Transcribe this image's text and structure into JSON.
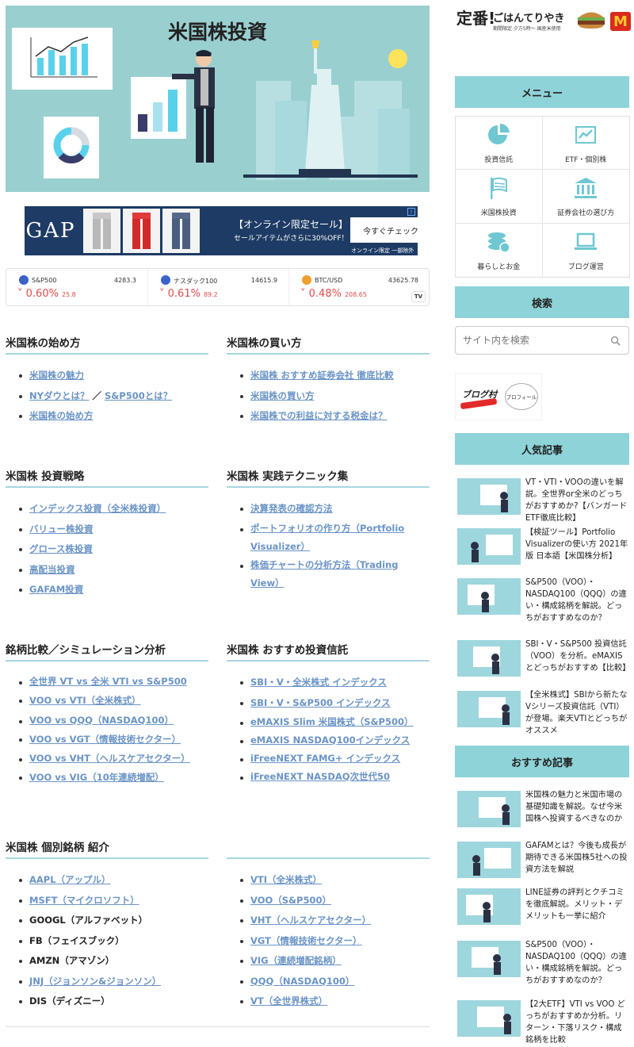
{
  "hero": {
    "title": "米国株投資"
  },
  "ad": {
    "logo": "GAP",
    "headline": "【オンライン限定セール】",
    "sub": "セールアイテムがさらに30%OFF！",
    "cta": "今すぐチェック",
    "note": "オンライン限定 一部除外品あり",
    "info": "i"
  },
  "ticker": [
    {
      "name": "S&P500",
      "price": "4283.3",
      "change": "0.60%",
      "sub": "25.8",
      "flag": "#3b62c8"
    },
    {
      "name": "ナスダック100",
      "price": "14615.9",
      "change": "0.61%",
      "sub": "89.2",
      "flag": "#3b62c8"
    },
    {
      "name": "BTC/USD",
      "price": "43625.78",
      "change": "0.48%",
      "sub": "208.65",
      "flag": "#f0a030"
    }
  ],
  "tv_badge": "TV",
  "sections": [
    {
      "title": "米国株の始め方",
      "items": [
        {
          "text": "米国株の魅力",
          "link": true
        },
        {
          "text": "NYダウとは？",
          "link": true,
          "extra_sep": " ／ ",
          "extra": "S&P500とは？"
        },
        {
          "text": "米国株の始め方",
          "link": true
        }
      ]
    },
    {
      "title": "米国株の買い方",
      "items": [
        {
          "text": "米国株 おすすめ証券会社 徹底比較",
          "link": true
        },
        {
          "text": "米国株の買い方",
          "link": true
        },
        {
          "text": "米国株での利益に対する税金は？",
          "link": true
        }
      ]
    },
    {
      "title": "米国株 投資戦略",
      "items": [
        {
          "text": "インデックス投資（全米株投資）",
          "link": true
        },
        {
          "text": "バリュー株投資",
          "link": true
        },
        {
          "text": "グロース株投資",
          "link": true
        },
        {
          "text": "高配当投資",
          "link": true
        },
        {
          "text": "GAFAM投資",
          "link": true
        }
      ]
    },
    {
      "title": "米国株 実践テクニック集",
      "items": [
        {
          "text": "決算発表の確認方法",
          "link": true
        },
        {
          "text": "ポートフォリオの作り方（Portfolio Visualizer）",
          "link": true
        },
        {
          "text": "株価チャートの分析方法（Trading View）",
          "link": true
        }
      ]
    },
    {
      "title": "銘柄比較／シミュレーション分析",
      "items": [
        {
          "text": "全世界 VT vs 全米 VTI vs S&P500",
          "link": true
        },
        {
          "text": "VOO vs VTI（全米株式）",
          "link": true
        },
        {
          "text": "VOO vs QQQ（NASDAQ100）",
          "link": true
        },
        {
          "text": "VOO vs VGT（情報技術セクター）",
          "link": true
        },
        {
          "text": "VOO vs VHT（ヘルスケアセクター）",
          "link": true
        },
        {
          "text": "VOO vs VIG（10年連続増配）",
          "link": true
        }
      ]
    },
    {
      "title": "米国株 おすすめ投資信託",
      "items": [
        {
          "text": "SBI・V・全米株式 インデックス",
          "link": true
        },
        {
          "text": "SBI・V・S&P500 インデックス",
          "link": true
        },
        {
          "text": "eMAXIS Slim 米国株式（S&P500）",
          "link": true
        },
        {
          "text": "eMAXIS NASDAQ100インデックス",
          "link": true
        },
        {
          "text": "iFreeNEXT FAMG+ インデックス",
          "link": true
        },
        {
          "text": "iFreeNEXT NASDAQ次世代50",
          "link": true
        }
      ]
    },
    {
      "title": "米国株 個別銘柄 紹介",
      "items": [
        {
          "text": "AAPL（アップル）",
          "link": true
        },
        {
          "text": "MSFT（マイクロソフト）",
          "link": true
        },
        {
          "text": "GOOGL（アルファベット）",
          "link": false
        },
        {
          "text": "FB（フェイスブック）",
          "link": false
        },
        {
          "text": "AMZN（アマゾン）",
          "link": false
        },
        {
          "text": "JNJ（ジョンソン&ジョンソン）",
          "link": true
        },
        {
          "text": "DIS（ディズニー）",
          "link": false
        }
      ]
    },
    {
      "title": "",
      "items": [
        {
          "text": "VTI（全米株式）",
          "link": true
        },
        {
          "text": "VOO（S&P500）",
          "link": true
        },
        {
          "text": "VHT（ヘルスケアセクター）",
          "link": true
        },
        {
          "text": "VGT（情報技術セクター）",
          "link": true
        },
        {
          "text": "VIG（連続増配銘柄）",
          "link": true
        },
        {
          "text": "QQQ（NASDAQ100）",
          "link": true
        },
        {
          "text": "VT（全世界株式）",
          "link": true
        }
      ]
    }
  ],
  "sidebar": {
    "top_ad": {
      "word": "定番!",
      "title": "ごはんてりやき",
      "sub": "期間限定 夕方5時〜 国産米使用",
      "brand": "M"
    },
    "menu_title": "メニュー",
    "menu": [
      {
        "label": "投資信託",
        "icon": "pie-chart-icon"
      },
      {
        "label": "ETF・個別株",
        "icon": "line-chart-icon"
      },
      {
        "label": "米国株投資",
        "icon": "flag-icon"
      },
      {
        "label": "証券会社の選び方",
        "icon": "bank-icon"
      },
      {
        "label": "暮らしとお金",
        "icon": "coins-icon"
      },
      {
        "label": "ブログ運営",
        "icon": "laptop-icon"
      }
    ],
    "search_title": "検索",
    "search_placeholder": "サイト内を検索",
    "blogmura": {
      "text": "ブログ村",
      "profile": "プロフィール"
    },
    "popular_title": "人気記事",
    "popular": [
      "VT・VTI・VOOの違いを解説。全世界or全米のどっちがおすすめか?【バンガードETF徹底比較】",
      "【検証ツール】Portfolio Visualizerの使い方 2021年版 日本語【米国株分析】",
      "S&P500（VOO）・NASDAQ100（QQQ）の違い・構成銘柄を解説。どっちがおすすめなのか？",
      "SBI・V・S&P500 投資信託（VOO）を分析。eMAXIS とどっちがおすすめ【比較】",
      "【全米株式】SBIから新たなVシリーズ投資信託（VTI）が登場。楽天VTIとどっちがオススメ"
    ],
    "recommended_title": "おすすめ記事",
    "recommended": [
      "米国株の魅力と米国市場の基礎知識を解説。なぜ今米国株へ投資するべきなのか",
      "GAFAMとは？今後も成長が期待できる米国株5社への投資方法を解説",
      "LINE証券の評判とクチコミを徹底解説。メリット・デメリットも一挙に紹介",
      "S&P500（VOO）・NASDAQ100（QQQ）の違い・構成銘柄を解説。どっちがおすすめなのか？",
      "【2大ETF】VTI vs VOO どっちがおすすめか分析。リターン・下落リスク・構成銘柄を比較"
    ]
  },
  "colors": {
    "accent": "#8ed3d8",
    "link": "#6a94c6",
    "hero_bg": "#9acfd0",
    "down": "#e04b4b"
  }
}
